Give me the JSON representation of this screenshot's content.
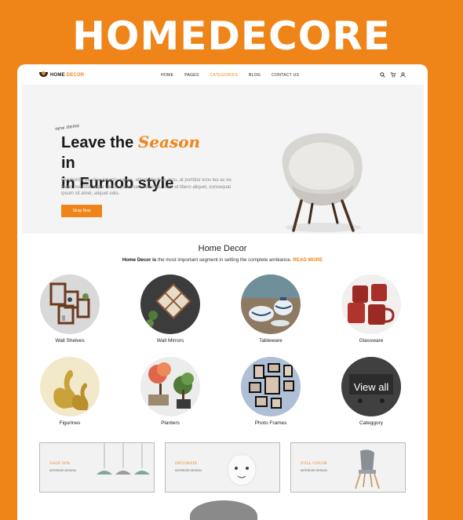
{
  "banner": {
    "title": "HOMEDECORE"
  },
  "header": {
    "logo_prefix": "HOME ",
    "logo_accent": "DECOR",
    "menu": [
      {
        "label": "HOME",
        "active": false
      },
      {
        "label": "PAGES",
        "active": false
      },
      {
        "label": "CATEGORIES",
        "active": true
      },
      {
        "label": "BLOG",
        "active": false
      },
      {
        "label": "CONTACT US",
        "active": false
      }
    ],
    "icons": [
      "search-icon",
      "cart-icon",
      "user-icon"
    ]
  },
  "hero": {
    "title_part1": "Leave the ",
    "title_highlight": "Season",
    "title_part2": " in",
    "title_line2": "in Furnob style",
    "tag": "new items",
    "description": "Ut lobortis, ex vitae lobortis cursus, elit nisl facilisis arcu, at porttitor eros leo ac ex. Nunc molestie turpis varius accumsan maximus. Nam ut libero aliquet, consequat ipsum sit amet, aliquet odio.",
    "button": "Shop Now"
  },
  "section": {
    "title": "Home Decor",
    "subtitle_bold": "Home Decor is",
    "subtitle_text": " the most important segment in setting the complete ambiance. ",
    "subtitle_link": "READ MORE"
  },
  "categories": [
    {
      "label": "Wall Shelves"
    },
    {
      "label": "Wall Mirrors"
    },
    {
      "label": "Tableware"
    },
    {
      "label": "Glassware"
    },
    {
      "label": "Figurines"
    },
    {
      "label": "Planters"
    },
    {
      "label": "Photo Frames"
    },
    {
      "label": "Categgory",
      "overlay": "View all"
    }
  ],
  "promos": [
    {
      "title": "SAGE 50%",
      "subtitle": "INTERIOR DESIGN"
    },
    {
      "title": "DECORATE",
      "subtitle": "INTERIOR DESIGN"
    },
    {
      "title": "FULL COLOR",
      "subtitle": "INTERIOR DESIGN"
    }
  ],
  "colors": {
    "brand": "#EF8419",
    "hero_bg": "#F4F4F4"
  }
}
